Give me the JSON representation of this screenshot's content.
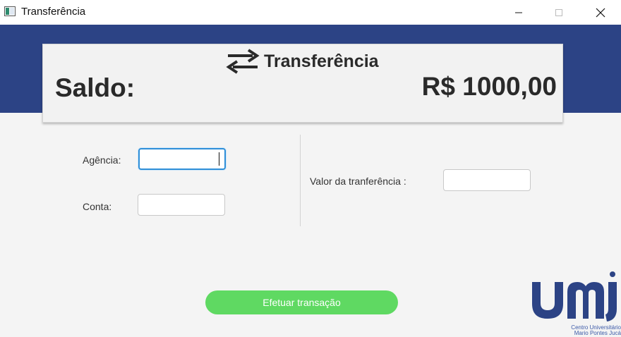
{
  "window": {
    "title": "Transferência",
    "controls": {
      "minimize_icon": "minimize-icon",
      "maximize_icon": "maximize-icon",
      "close_icon": "close-icon"
    }
  },
  "header": {
    "icon": "swap-arrows-icon",
    "title": "Transferência",
    "saldo_label": "Saldo:",
    "saldo_value": "R$ 1000,00"
  },
  "form": {
    "agencia": {
      "label": "Agência:",
      "value": ""
    },
    "conta": {
      "label": "Conta:",
      "value": ""
    },
    "valor": {
      "label": "Valor da tranferência :",
      "value": ""
    },
    "submit_label": "Efetuar transação"
  },
  "logo": {
    "text": "UMJ",
    "subtitle_1": "Centro Universitário",
    "subtitle_2": "Mario Pontes Jucá",
    "color": "#2c4385"
  },
  "colors": {
    "banner": "#2c4385",
    "button": "#5fd962",
    "focus": "#2f8fd8"
  }
}
